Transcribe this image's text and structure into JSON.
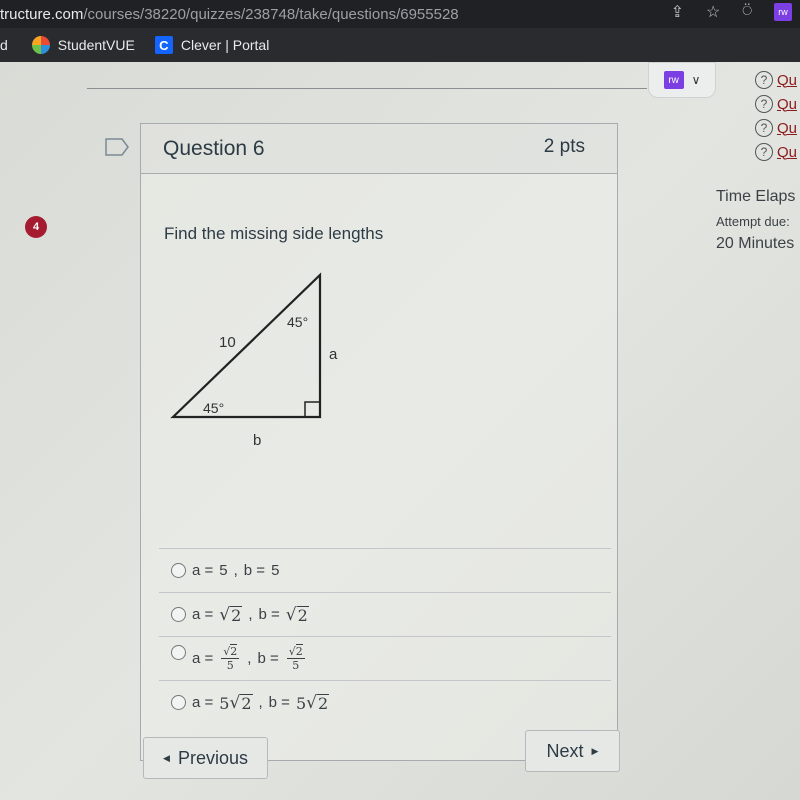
{
  "browser": {
    "url_host": "tructure.com",
    "url_path": "/courses/38220/quizzes/238748/take/questions/6955528",
    "extension_label": "rw",
    "bookmarks": [
      {
        "label": "d",
        "icon": "none"
      },
      {
        "label": "StudentVUE",
        "icon": "studentvue-icon"
      },
      {
        "label": "Clever | Portal",
        "icon": "clever-icon"
      }
    ]
  },
  "toolbar": {
    "rw_label": "rw",
    "chevron": "⌄"
  },
  "sidebar": {
    "question_links": [
      {
        "label": "Qu"
      },
      {
        "label": "Qu"
      },
      {
        "label": "Qu"
      },
      {
        "label": "Qu"
      }
    ],
    "time_elapsed_label": "Time Elaps",
    "attempt_due_label": "Attempt due:",
    "minutes_label": "20 Minutes"
  },
  "badge": {
    "count": "4",
    "color": "#a51c30"
  },
  "question": {
    "title": "Question 6",
    "points": "2 pts",
    "prompt": "Find the missing side lengths",
    "figure": {
      "hypotenuse_label": "10",
      "top_angle": "45°",
      "bottom_angle": "45°",
      "vertical_side_label": "a",
      "horizontal_side_label": "b"
    },
    "answers": [
      {
        "a": "5",
        "b": "5"
      },
      {
        "a": "√2",
        "b": "√2"
      },
      {
        "a": "√2/5",
        "b": "√2/5"
      },
      {
        "a": "5√2",
        "b": "5√2"
      }
    ]
  },
  "text": {
    "a_eq": "a =",
    "b_eq": "b =",
    "comma": ",",
    "radical": "√",
    "two": "2",
    "five": "5"
  },
  "nav": {
    "previous_label": "Previous",
    "next_label": "Next",
    "prev_arrow": "◀",
    "next_arrow": "▶"
  }
}
